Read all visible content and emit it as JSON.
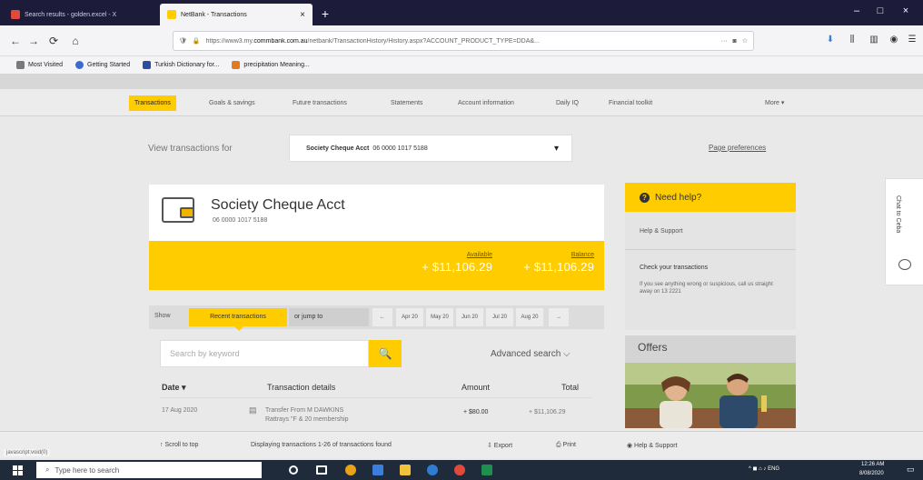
{
  "browser": {
    "tabs": [
      {
        "label": "Search results - golden.excel - X",
        "favicon_color": "#e14a3a"
      },
      {
        "label": "NetBank - Transactions",
        "favicon_color": "#ffcc00",
        "close": "×"
      }
    ],
    "new_tab": "+",
    "window_controls": [
      "–",
      "□",
      "×"
    ],
    "url": {
      "prefix": "https://www3.my.",
      "domain": "commbank.com.au",
      "path": "/netbank/TransactionHistory/History.aspx?ACCOUNT_PRODUCT_TYPE=DDA&..."
    },
    "url_more": "···",
    "nav": {
      "back": "←",
      "forward": "→",
      "reload": "⟳",
      "home": "⌂"
    },
    "bookmarks": [
      {
        "label": "Most Visited",
        "color": "#7a7a7a"
      },
      {
        "label": "Getting Started",
        "color": "#3a6bd0"
      },
      {
        "label": "Turkish Dictionary for...",
        "color": "#2a4f9e"
      },
      {
        "label": "precipitation Meaning...",
        "color": "#e07b1f"
      }
    ]
  },
  "main_nav": {
    "items": [
      "Transactions",
      "Goals & savings",
      "Future transactions",
      "Statements",
      "Account information",
      "Daily IQ",
      "Financial toolkit"
    ],
    "more": "More ▾"
  },
  "view_for": {
    "label": "View transactions for",
    "account_bold": "Society Cheque Acct",
    "account_number": "06 0000 1017 5188",
    "caret": "▾"
  },
  "page_prefs": "Page preferences",
  "account": {
    "name": "Society Cheque Acct",
    "number": "06 0000 1017 5188",
    "available_label": "Available",
    "available": "+ $11,106.29",
    "balance_label": "Balance",
    "balance": "+ $11,106.29"
  },
  "filter": {
    "show": "Show",
    "recent": "Recent transactions",
    "jump": "or jump to",
    "prev": "←",
    "months": [
      "Apr 20",
      "May 20",
      "Jun 20",
      "Jul 20",
      "Aug 20"
    ],
    "next": "→"
  },
  "search": {
    "placeholder": "Search by keyword",
    "button": "🔍",
    "advanced": "Advanced search ⌵"
  },
  "table": {
    "headers": {
      "date": "Date ▾",
      "details": "Transaction details",
      "amount": "Amount",
      "total": "Total"
    },
    "rows": [
      {
        "date": "17 Aug 2020",
        "details_line1": "Transfer From M DAWKINS",
        "details_line2": "Rattrays \"F & 20 membership",
        "amount": "+ $80.00",
        "total": "+ $11,106.29"
      }
    ]
  },
  "help": {
    "title": "Need help?",
    "link": "Help & Support",
    "check_title": "Check your transactions",
    "check_body": "If you see anything wrong or suspicious, call us straight away on 13 2221"
  },
  "offers": {
    "title": "Offers"
  },
  "chat": {
    "label": "Chat to Ceba"
  },
  "footer": {
    "back_to_top": "↑  Scroll to top",
    "displaying": "Displaying transactions 1-26 of transactions found",
    "export": "⇩  Export",
    "print": "⎙  Print",
    "help": "◉  Help & Support"
  },
  "status_url": "javascript:void(0)",
  "taskbar": {
    "search_placeholder": "Type here to search",
    "tray_text": "^  ◼  ⌂  ♪  ENG",
    "time": "12:26 AM",
    "date": "8/08/2020",
    "apps": [
      "#ffffff",
      "#ffffff",
      "#e8a317",
      "#3b7ddd",
      "#f3c43b",
      "#2d7dd2",
      "#e14a3a",
      "#1e8f4e"
    ]
  }
}
